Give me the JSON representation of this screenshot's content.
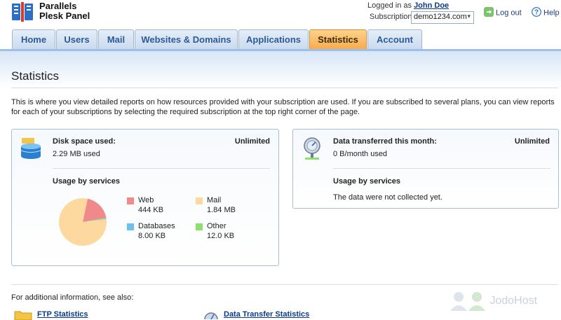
{
  "brand": {
    "line1": "Parallels",
    "line2": "Plesk Panel"
  },
  "header": {
    "logged_prefix": "Logged in as",
    "user_name": "John Doe",
    "subscription_label": "Subscription",
    "subscription_value": "demo1234.com",
    "logout_label": "Log out",
    "help_label": "Help"
  },
  "tabs": [
    {
      "label": "Home"
    },
    {
      "label": "Users"
    },
    {
      "label": "Mail"
    },
    {
      "label": "Websites & Domains"
    },
    {
      "label": "Applications"
    },
    {
      "label": "Statistics",
      "active": true
    },
    {
      "label": "Account"
    }
  ],
  "page": {
    "title": "Statistics",
    "intro": "This is where you view detailed reports on how resources provided with your subscription are used. If you are subscribed to several plans, you can view reports for each of your subscriptions by selecting the required subscription at the top right corner of the page."
  },
  "disk": {
    "label": "Disk space used:",
    "limit": "Unlimited",
    "used": "2.29 MB used",
    "usage_title": "Usage by services",
    "services": [
      {
        "name": "Web",
        "value": "444 KB",
        "color": "#f08a8a",
        "kb": 444
      },
      {
        "name": "Mail",
        "value": "1.84 MB",
        "color": "#fdd9a0",
        "kb": 1884
      },
      {
        "name": "Databases",
        "value": "8.00 KB",
        "color": "#6cc0f0",
        "kb": 8
      },
      {
        "name": "Other",
        "value": "12.0 KB",
        "color": "#8de06a",
        "kb": 12
      }
    ]
  },
  "traffic": {
    "label": "Data transferred this month:",
    "limit": "Unlimited",
    "used": "0 B/month used",
    "usage_title": "Usage by services",
    "note": "The data were not collected yet."
  },
  "footer": {
    "see_also": "For additional information, see also:",
    "link_ftp": "FTP Statistics",
    "link_transfer": "Data Transfer Statistics",
    "watermark": "JodoHost"
  }
}
